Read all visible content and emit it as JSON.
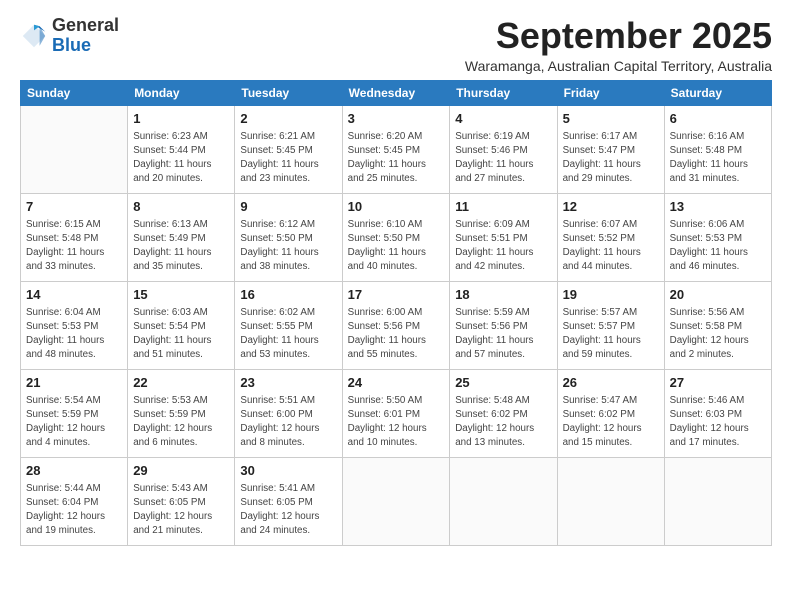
{
  "logo": {
    "general": "General",
    "blue": "Blue"
  },
  "title": "September 2025",
  "subtitle": "Waramanga, Australian Capital Territory, Australia",
  "days_of_week": [
    "Sunday",
    "Monday",
    "Tuesday",
    "Wednesday",
    "Thursday",
    "Friday",
    "Saturday"
  ],
  "weeks": [
    [
      {
        "day": null,
        "info": ""
      },
      {
        "day": "1",
        "info": "Sunrise: 6:23 AM\nSunset: 5:44 PM\nDaylight: 11 hours\nand 20 minutes."
      },
      {
        "day": "2",
        "info": "Sunrise: 6:21 AM\nSunset: 5:45 PM\nDaylight: 11 hours\nand 23 minutes."
      },
      {
        "day": "3",
        "info": "Sunrise: 6:20 AM\nSunset: 5:45 PM\nDaylight: 11 hours\nand 25 minutes."
      },
      {
        "day": "4",
        "info": "Sunrise: 6:19 AM\nSunset: 5:46 PM\nDaylight: 11 hours\nand 27 minutes."
      },
      {
        "day": "5",
        "info": "Sunrise: 6:17 AM\nSunset: 5:47 PM\nDaylight: 11 hours\nand 29 minutes."
      },
      {
        "day": "6",
        "info": "Sunrise: 6:16 AM\nSunset: 5:48 PM\nDaylight: 11 hours\nand 31 minutes."
      }
    ],
    [
      {
        "day": "7",
        "info": "Sunrise: 6:15 AM\nSunset: 5:48 PM\nDaylight: 11 hours\nand 33 minutes."
      },
      {
        "day": "8",
        "info": "Sunrise: 6:13 AM\nSunset: 5:49 PM\nDaylight: 11 hours\nand 35 minutes."
      },
      {
        "day": "9",
        "info": "Sunrise: 6:12 AM\nSunset: 5:50 PM\nDaylight: 11 hours\nand 38 minutes."
      },
      {
        "day": "10",
        "info": "Sunrise: 6:10 AM\nSunset: 5:50 PM\nDaylight: 11 hours\nand 40 minutes."
      },
      {
        "day": "11",
        "info": "Sunrise: 6:09 AM\nSunset: 5:51 PM\nDaylight: 11 hours\nand 42 minutes."
      },
      {
        "day": "12",
        "info": "Sunrise: 6:07 AM\nSunset: 5:52 PM\nDaylight: 11 hours\nand 44 minutes."
      },
      {
        "day": "13",
        "info": "Sunrise: 6:06 AM\nSunset: 5:53 PM\nDaylight: 11 hours\nand 46 minutes."
      }
    ],
    [
      {
        "day": "14",
        "info": "Sunrise: 6:04 AM\nSunset: 5:53 PM\nDaylight: 11 hours\nand 48 minutes."
      },
      {
        "day": "15",
        "info": "Sunrise: 6:03 AM\nSunset: 5:54 PM\nDaylight: 11 hours\nand 51 minutes."
      },
      {
        "day": "16",
        "info": "Sunrise: 6:02 AM\nSunset: 5:55 PM\nDaylight: 11 hours\nand 53 minutes."
      },
      {
        "day": "17",
        "info": "Sunrise: 6:00 AM\nSunset: 5:56 PM\nDaylight: 11 hours\nand 55 minutes."
      },
      {
        "day": "18",
        "info": "Sunrise: 5:59 AM\nSunset: 5:56 PM\nDaylight: 11 hours\nand 57 minutes."
      },
      {
        "day": "19",
        "info": "Sunrise: 5:57 AM\nSunset: 5:57 PM\nDaylight: 11 hours\nand 59 minutes."
      },
      {
        "day": "20",
        "info": "Sunrise: 5:56 AM\nSunset: 5:58 PM\nDaylight: 12 hours\nand 2 minutes."
      }
    ],
    [
      {
        "day": "21",
        "info": "Sunrise: 5:54 AM\nSunset: 5:59 PM\nDaylight: 12 hours\nand 4 minutes."
      },
      {
        "day": "22",
        "info": "Sunrise: 5:53 AM\nSunset: 5:59 PM\nDaylight: 12 hours\nand 6 minutes."
      },
      {
        "day": "23",
        "info": "Sunrise: 5:51 AM\nSunset: 6:00 PM\nDaylight: 12 hours\nand 8 minutes."
      },
      {
        "day": "24",
        "info": "Sunrise: 5:50 AM\nSunset: 6:01 PM\nDaylight: 12 hours\nand 10 minutes."
      },
      {
        "day": "25",
        "info": "Sunrise: 5:48 AM\nSunset: 6:02 PM\nDaylight: 12 hours\nand 13 minutes."
      },
      {
        "day": "26",
        "info": "Sunrise: 5:47 AM\nSunset: 6:02 PM\nDaylight: 12 hours\nand 15 minutes."
      },
      {
        "day": "27",
        "info": "Sunrise: 5:46 AM\nSunset: 6:03 PM\nDaylight: 12 hours\nand 17 minutes."
      }
    ],
    [
      {
        "day": "28",
        "info": "Sunrise: 5:44 AM\nSunset: 6:04 PM\nDaylight: 12 hours\nand 19 minutes."
      },
      {
        "day": "29",
        "info": "Sunrise: 5:43 AM\nSunset: 6:05 PM\nDaylight: 12 hours\nand 21 minutes."
      },
      {
        "day": "30",
        "info": "Sunrise: 5:41 AM\nSunset: 6:05 PM\nDaylight: 12 hours\nand 24 minutes."
      },
      {
        "day": null,
        "info": ""
      },
      {
        "day": null,
        "info": ""
      },
      {
        "day": null,
        "info": ""
      },
      {
        "day": null,
        "info": ""
      }
    ]
  ]
}
